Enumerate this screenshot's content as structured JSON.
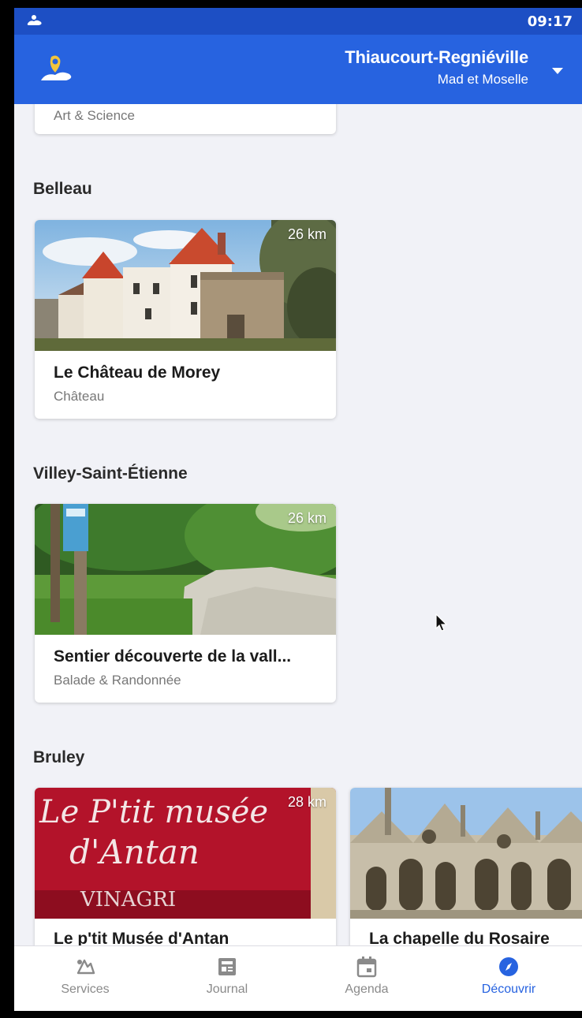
{
  "status_bar": {
    "time": "09:17"
  },
  "header": {
    "city": "Thiaucourt-Regniéville",
    "region": "Mad et Moselle"
  },
  "colors": {
    "brand": "#2763e0",
    "status_bar": "#1d4fc4",
    "active_nav": "#2763e0"
  },
  "partial_card": {
    "subtitle": "Art & Science"
  },
  "sections": [
    {
      "title": "Belleau",
      "cards": [
        {
          "title": "Le Château de Morey",
          "subtitle": "Château",
          "distance": "26 km"
        }
      ]
    },
    {
      "title": "Villey-Saint-Étienne",
      "cards": [
        {
          "title": "Sentier découverte de la vall...",
          "subtitle": "Balade & Randonnée",
          "distance": "26 km"
        }
      ]
    },
    {
      "title": "Bruley",
      "cards": [
        {
          "title": "Le p'tit Musée d'Antan",
          "subtitle": "",
          "distance": "28 km",
          "sign_text": [
            "Le P'tit musée",
            "d'Antan",
            "VINAGRI"
          ]
        },
        {
          "title": "La chapelle du Rosaire",
          "subtitle": ""
        }
      ]
    }
  ],
  "bottom_nav": [
    {
      "label": "Services",
      "icon": "services-icon",
      "active": false
    },
    {
      "label": "Journal",
      "icon": "newspaper-icon",
      "active": false
    },
    {
      "label": "Agenda",
      "icon": "calendar-icon",
      "active": false
    },
    {
      "label": "Découvrir",
      "icon": "compass-icon",
      "active": true
    }
  ]
}
